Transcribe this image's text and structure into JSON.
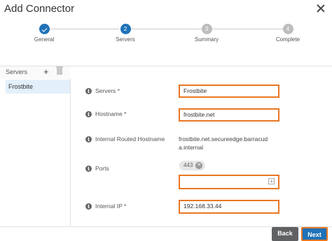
{
  "dialog": {
    "title": "Add Connector"
  },
  "stepper": {
    "steps": [
      {
        "number": "",
        "label": "General",
        "state": "done"
      },
      {
        "number": "2",
        "label": "Servers",
        "state": "active"
      },
      {
        "number": "3",
        "label": "Summary",
        "state": "todo"
      },
      {
        "number": "4",
        "label": "Complete",
        "state": "todo"
      }
    ]
  },
  "sidebar": {
    "header": "Servers",
    "items": [
      {
        "label": "Frostbite"
      }
    ]
  },
  "form": {
    "servers": {
      "label": "Servers *",
      "value": "Frostbite"
    },
    "hostname": {
      "label": "Hostname *",
      "value": "frostbite.net"
    },
    "internal_routed_hostname": {
      "label": "Internal Routed Hostname",
      "value": "frostbite.net.secureedge.barracuda.internal"
    },
    "ports": {
      "label": "Ports",
      "chips": [
        "443"
      ],
      "value": ""
    },
    "internal_ip": {
      "label": "Internal IP *",
      "value": "192.168.33.44"
    }
  },
  "footer": {
    "back_label": "Back",
    "next_label": "Next"
  },
  "colors": {
    "accent": "#1f72b8",
    "highlight": "#e87722"
  }
}
